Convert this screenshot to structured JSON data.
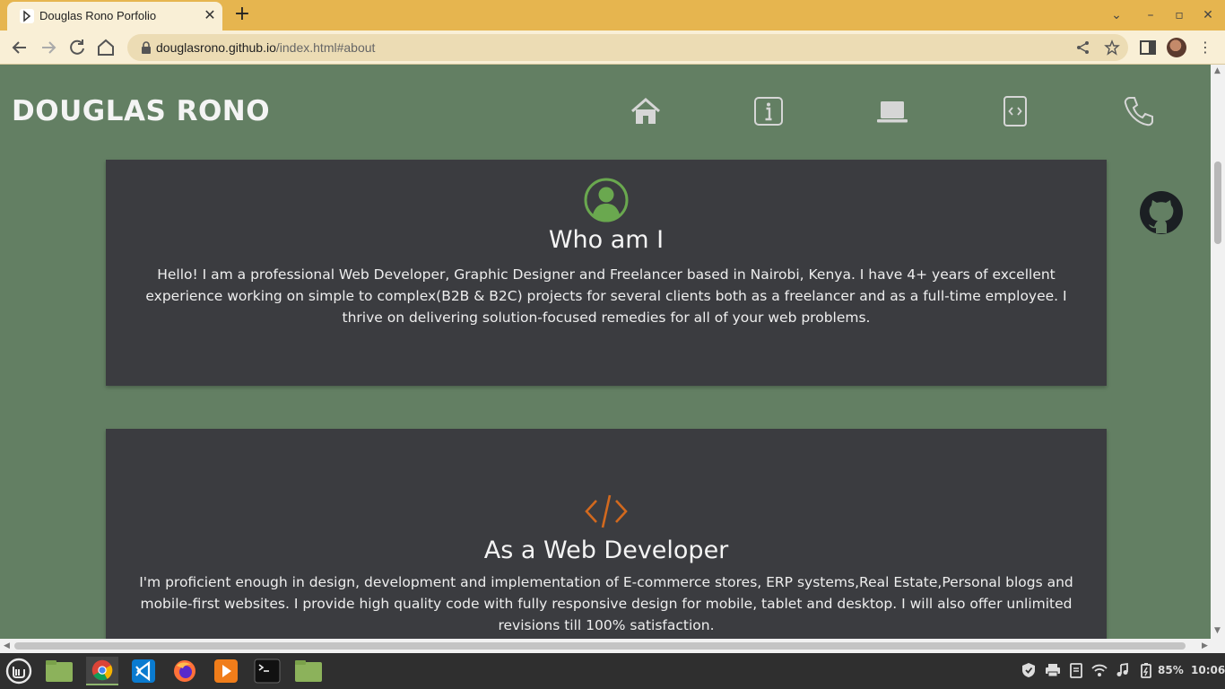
{
  "browser": {
    "tab_title": "Douglas Rono Porfolio",
    "tab_close": "✕",
    "new_tab": "+",
    "url_host": "douglasrono.github.io",
    "url_path": "/index.html#about",
    "win_min": "–",
    "win_max": "▫",
    "win_close": "✕",
    "tab_search": "⌄",
    "menu": "⋮"
  },
  "header": {
    "brand": "DOUGLAS RONO",
    "nav": [
      "home-icon",
      "info-icon",
      "laptop-icon",
      "code-file-icon",
      "phone-icon"
    ]
  },
  "about": {
    "icon": "user-circle-icon",
    "heading": "Who am I",
    "text": "Hello! I am a professional Web Developer, Graphic Designer and Freelancer based in Nairobi, Kenya. I have 4+ years of excellent experience working on simple to complex(B2B & B2C) projects for several clients both as a freelancer and as a full-time employee. I thrive on delivering solution-focused remedies for all of your web problems."
  },
  "web_dev": {
    "icon": "code-icon",
    "heading": "As a Web Developer",
    "text": "I'm proficient enough in design, development and implementation of E-commerce stores, ERP systems,Real Estate,Personal blogs and mobile-first websites. I provide high quality code with fully responsive design for mobile, tablet and desktop. I will also offer unlimited revisions till 100% satisfaction."
  },
  "taskbar": {
    "battery": "85%",
    "time": "10:06"
  },
  "colors": {
    "page_bg": "#637f63",
    "card_bg": "#3b3c40",
    "accent_green": "#6aa84f",
    "accent_orange": "#d2691e",
    "tabbar": "#e6b54f"
  }
}
